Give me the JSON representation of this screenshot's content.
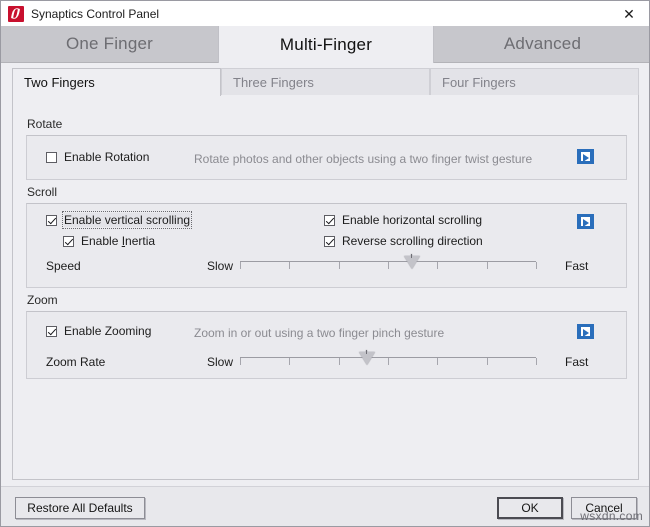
{
  "window": {
    "title": "Synaptics Control Panel",
    "app_icon": "synaptics-logo-icon",
    "close_label": "✕"
  },
  "outer_tabs": [
    {
      "label": "One Finger",
      "active": false
    },
    {
      "label": "Multi-Finger",
      "active": true
    },
    {
      "label": "Advanced",
      "active": false
    }
  ],
  "inner_tabs": [
    {
      "label": "Two Fingers",
      "active": true
    },
    {
      "label": "Three Fingers",
      "active": false
    },
    {
      "label": "Four Fingers",
      "active": false
    }
  ],
  "groups": {
    "rotate": {
      "title": "Rotate",
      "enable_rotation": {
        "label": "Enable Rotation",
        "checked": false
      },
      "description": "Rotate photos and other objects using a two finger twist gesture",
      "video_icon": "video-preview-icon"
    },
    "scroll": {
      "title": "Scroll",
      "enable_vertical": {
        "label": "Enable vertical scrolling",
        "checked": true,
        "focused": true
      },
      "enable_inertia": {
        "label_before": "Enable ",
        "label_accel": "I",
        "label_after": "nertia",
        "label": "Enable Inertia",
        "checked": true
      },
      "enable_horizontal": {
        "label": "Enable horizontal scrolling",
        "checked": true
      },
      "reverse_direction": {
        "label": "Reverse scrolling direction",
        "checked": true
      },
      "speed": {
        "label": "Speed",
        "min_label": "Slow",
        "max_label": "Fast",
        "value_percent": 58,
        "ticks": 7
      },
      "video_icon": "video-preview-icon"
    },
    "zoom": {
      "title": "Zoom",
      "enable_zooming": {
        "label": "Enable Zooming",
        "checked": true
      },
      "description": "Zoom in or out using a two finger pinch gesture",
      "zoom_rate": {
        "label": "Zoom Rate",
        "min_label": "Slow",
        "max_label": "Fast",
        "value_percent": 43,
        "ticks": 7
      },
      "video_icon": "video-preview-icon"
    }
  },
  "footer": {
    "restore_label": "Restore All Defaults",
    "ok_label": "OK",
    "cancel_label": "Cancel"
  },
  "watermark": "wsxdn.com",
  "colors": {
    "accent": "#2a6ebb",
    "brand": "#c8102e",
    "panel": "#eeeef2",
    "chrome": "#e8e8ec"
  }
}
